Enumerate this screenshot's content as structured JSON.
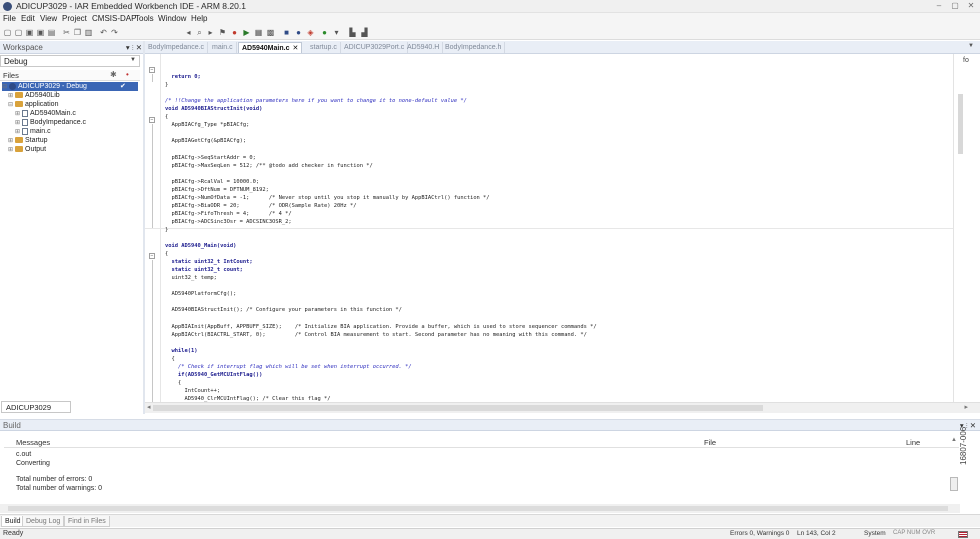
{
  "window": {
    "title": "ADICUP3029 - IAR Embedded Workbench IDE - ARM 8.20.1",
    "controls": [
      "–",
      "▢",
      "✕"
    ]
  },
  "menu": [
    "File",
    "Edit",
    "View",
    "Project",
    "CMSIS-DAP",
    "Tools",
    "Window",
    "Help"
  ],
  "workspace": {
    "title": "Workspace",
    "controls": "▾ ⫶ ✕",
    "configuration": "Debug",
    "files_label": "Files",
    "tree": [
      {
        "label": "ADICUP3029 - Debug",
        "icon": "project-icon",
        "selected": true,
        "check": "✔"
      },
      {
        "label": "AD5940Lib",
        "icon": "folder-icon"
      },
      {
        "label": "application",
        "icon": "folder-icon"
      },
      {
        "label": "AD5940Main.c",
        "icon": "file-icon"
      },
      {
        "label": "BodyImpedance.c",
        "icon": "file-icon"
      },
      {
        "label": "main.c",
        "icon": "file-icon"
      },
      {
        "label": "Startup",
        "icon": "folder-icon"
      },
      {
        "label": "Output",
        "icon": "folder-icon"
      }
    ],
    "bottom_tab": "ADICUP3029"
  },
  "editor": {
    "tabs": [
      {
        "label": "BodyImpedance.c",
        "active": false
      },
      {
        "label": "main.c",
        "active": false
      },
      {
        "label": "AD5940Main.c",
        "active": true
      },
      {
        "label": "startup.c",
        "active": false
      },
      {
        "label": "ADICUP3029Port.c",
        "active": false
      },
      {
        "label": "AD5940.H",
        "active": false
      },
      {
        "label": "BodyImpedance.h",
        "active": false
      }
    ],
    "tab_close": "✕",
    "rail_label": "fo"
  },
  "code": [
    "  return 0;",
    "}",
    "",
    "/* !!Change the application parameters here if you want to change it to none-default value */",
    "void AD5940BIAStructInit(void)",
    "{",
    "  AppBIACfg_Type *pBIACfg;",
    "",
    "  AppBIAGetCfg(&pBIACfg);",
    "",
    "  pBIACfg->SeqStartAddr = 0;",
    "  pBIACfg->MaxSeqLen = 512; /** @todo add checker in function */",
    "",
    "  pBIACfg->RcalVal = 10000.0;",
    "  pBIACfg->DftNum = DFTNUM_8192;",
    "  pBIACfg->NumOfData = -1;      /* Never stop until you stop it manually by AppBIACtrl() function */",
    "  pBIACfg->BiaODR = 20;         /* ODR(Sample Rate) 20Hz */",
    "  pBIACfg->FifoThresh = 4;      /* 4 */",
    "  pBIACfg->ADCSinc3Osr = ADCSINC3OSR_2;",
    "}",
    "",
    "void AD5940_Main(void)",
    "{",
    "  static uint32_t IntCount;",
    "  static uint32_t count;",
    "  uint32_t temp;",
    "",
    "  AD5940PlatformCfg();",
    "",
    "  AD5940BIAStructInit(); /* Configure your parameters in this function */",
    "",
    "  AppBIAInit(AppBuff, APPBUFF_SIZE);    /* Initialize BIA application. Provide a buffer, which is used to store sequencer commands */",
    "  AppBIACtrl(BIACTRL_START, 0);         /* Control BIA measurement to start. Second parameter has no meaning with this command. */",
    "",
    "  while(1)",
    "  {",
    "    /* Check if interrupt flag which will be set when interrupt occurred. */",
    "    if(AD5940_GetMCUIntFlag())",
    "    {",
    "      IntCount++;",
    "      AD5940_ClrMCUIntFlag(); /* Clear this flag */"
  ],
  "build": {
    "title": "Build",
    "controls": "▾ ⫶ ✕",
    "columns": {
      "messages": "Messages",
      "file": "File",
      "line": "Line"
    },
    "messages": [
      "c.out",
      "Converting",
      "",
      "Total number of errors: 0",
      "Total number of warnings: 0"
    ]
  },
  "bottom_tabs": [
    "Build",
    "Debug Log",
    "Find in Files"
  ],
  "status": {
    "ready": "Ready",
    "errors": "Errors 0, Warnings 0",
    "position": "Ln 143, Col 2",
    "system": "System",
    "flags": "CAP  NUM  OVR"
  },
  "figure_id": "16807-006"
}
